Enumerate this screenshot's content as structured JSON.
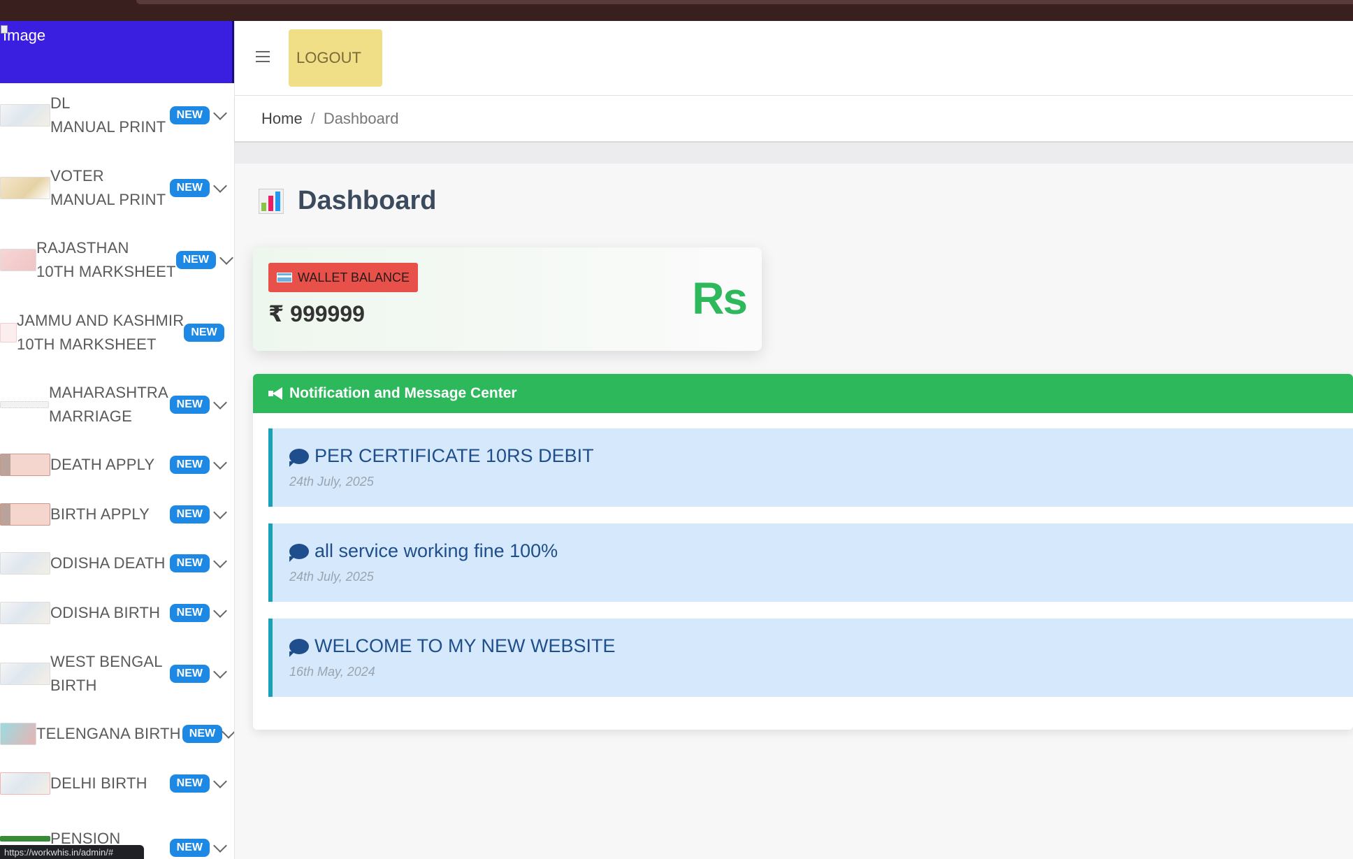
{
  "logo": {
    "alt_text": "Image"
  },
  "sidebar": {
    "items": [
      {
        "line1": "DL",
        "line2": "MANUAL PRINT",
        "badge": "NEW"
      },
      {
        "line1": "VOTER",
        "line2": "MANUAL PRINT",
        "badge": "NEW"
      },
      {
        "line1": "RAJASTHAN",
        "line2": "10TH MARKSHEET",
        "badge": "NEW"
      },
      {
        "line1": "JAMMU AND KASHMIR",
        "line2": "10TH MARKSHEET",
        "badge": "NEW"
      },
      {
        "line1": "MAHARASHTRA",
        "line2": "MARRIAGE",
        "badge": "NEW"
      },
      {
        "line1": "DEATH APPLY",
        "badge": "NEW"
      },
      {
        "line1": "BIRTH APPLY",
        "badge": "NEW"
      },
      {
        "line1": "ODISHA DEATH",
        "badge": "NEW"
      },
      {
        "line1": "ODISHA BIRTH",
        "badge": "NEW"
      },
      {
        "line1": "WEST BENGAL",
        "line2": "BIRTH",
        "badge": "NEW"
      },
      {
        "line1": "TELENGANA BIRTH",
        "badge": "NEW"
      },
      {
        "line1": "DELHI BIRTH",
        "badge": "NEW"
      },
      {
        "line1": "PENSION",
        "badge": "NEW"
      }
    ]
  },
  "header": {
    "logout_label": "LOGOUT"
  },
  "breadcrumb": {
    "home": "Home",
    "separator": "/",
    "current": "Dashboard"
  },
  "page": {
    "title": "Dashboard"
  },
  "wallet": {
    "label": "WALLET BALANCE",
    "amount": "₹ 999999",
    "currency_symbol": "Rs"
  },
  "notifications": {
    "header": "Notification and Message Center",
    "items": [
      {
        "title": "PER CERTIFICATE 10RS DEBIT",
        "date": "24th July, 2025"
      },
      {
        "title": "all service working fine 100%",
        "date": "24th July, 2025"
      },
      {
        "title": "WELCOME TO MY NEW WEBSITE",
        "date": "16th May, 2024"
      }
    ]
  },
  "status_bar": {
    "url": "https://workwhis.in/admin/#"
  },
  "colors": {
    "accent_green": "#2eb85c",
    "badge_blue": "#1e88e5",
    "logo_bg": "#3a1fe0",
    "logout_bg": "#f0df86",
    "wallet_badge": "#e8514a"
  }
}
